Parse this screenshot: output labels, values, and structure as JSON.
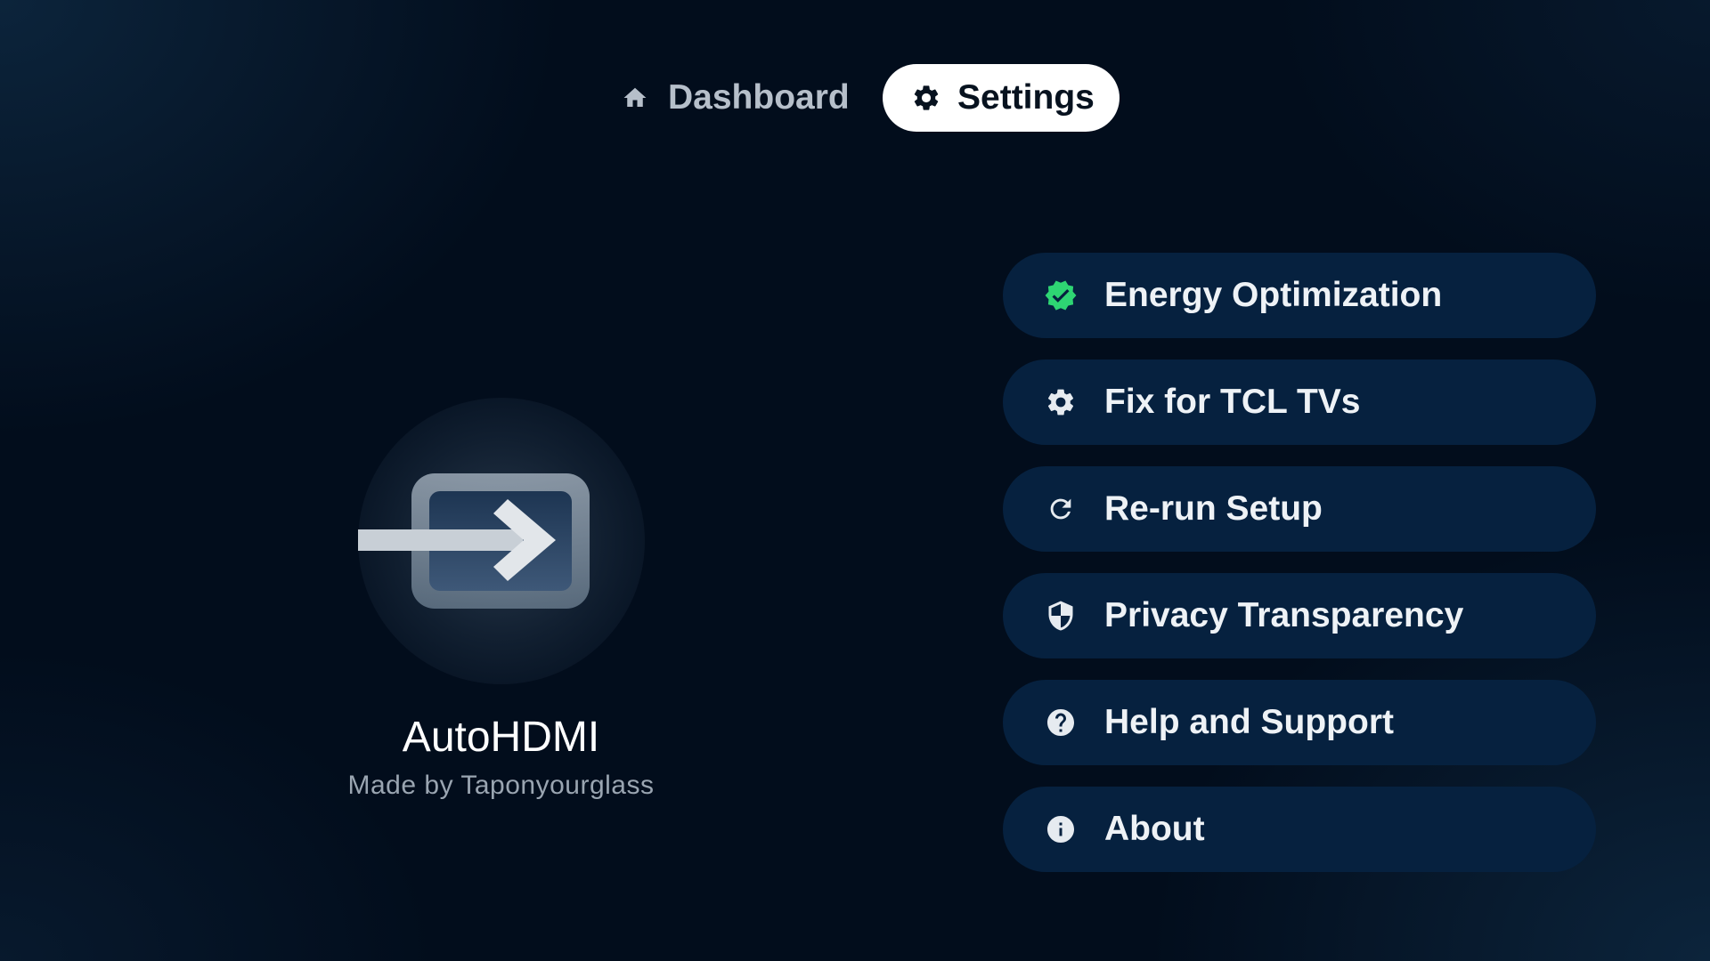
{
  "nav": {
    "tabs": [
      {
        "label": "Dashboard",
        "icon": "home-icon",
        "active": false
      },
      {
        "label": "Settings",
        "icon": "gear-icon",
        "active": true
      }
    ]
  },
  "app": {
    "name": "AutoHDMI",
    "credit": "Made by Taponyourglass",
    "logo_icon": "hdmi-input-arrow-icon"
  },
  "settings": {
    "items": [
      {
        "label": "Energy Optimization",
        "icon": "verified-check-icon",
        "icon_color": "#2ed573"
      },
      {
        "label": "Fix for TCL TVs",
        "icon": "gear-icon",
        "icon_color": "#e6ebf0"
      },
      {
        "label": "Re-run Setup",
        "icon": "refresh-icon",
        "icon_color": "#e6ebf0"
      },
      {
        "label": "Privacy Transparency",
        "icon": "shield-icon",
        "icon_color": "#e6ebf0"
      },
      {
        "label": "Help and Support",
        "icon": "help-icon",
        "icon_color": "#e6ebf0"
      },
      {
        "label": "About",
        "icon": "info-icon",
        "icon_color": "#e6ebf0"
      }
    ]
  },
  "colors": {
    "background": "#020d1c",
    "menu_item_bg": "#06213f",
    "active_tab_bg": "#ffffff",
    "accent_green": "#2ed573"
  }
}
